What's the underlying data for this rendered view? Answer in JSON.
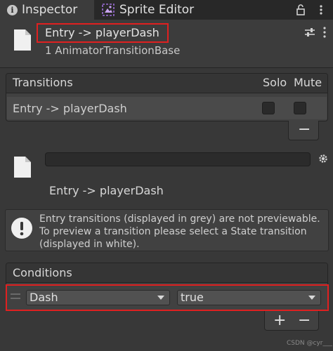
{
  "tabs": [
    {
      "label": "Inspector",
      "icon": "info-icon",
      "active": true
    },
    {
      "label": "Sprite Editor",
      "icon": "sprite-editor-icon",
      "active": false
    }
  ],
  "header": {
    "title": "Entry -> playerDash",
    "subtitle": "1 AnimatorTransitionBase"
  },
  "transitions": {
    "title": "Transitions",
    "solo_label": "Solo",
    "mute_label": "Mute",
    "rows": [
      {
        "label": "Entry -> playerDash",
        "solo": false,
        "mute": false
      }
    ],
    "remove_glyph": "−"
  },
  "detail": {
    "name": "Entry -> playerDash"
  },
  "help": {
    "text": "Entry transitions (displayed in grey) are not previewable. To preview a transition please select a State transition (displayed in white)."
  },
  "conditions": {
    "title": "Conditions",
    "rows": [
      {
        "parameter": "Dash",
        "value": "true"
      }
    ],
    "add_glyph": "+",
    "remove_glyph": "−"
  },
  "watermark": "CSDN @cyr___",
  "colors": {
    "background": "#383838",
    "highlight": "#e02020",
    "text": "#d2d2d2"
  }
}
